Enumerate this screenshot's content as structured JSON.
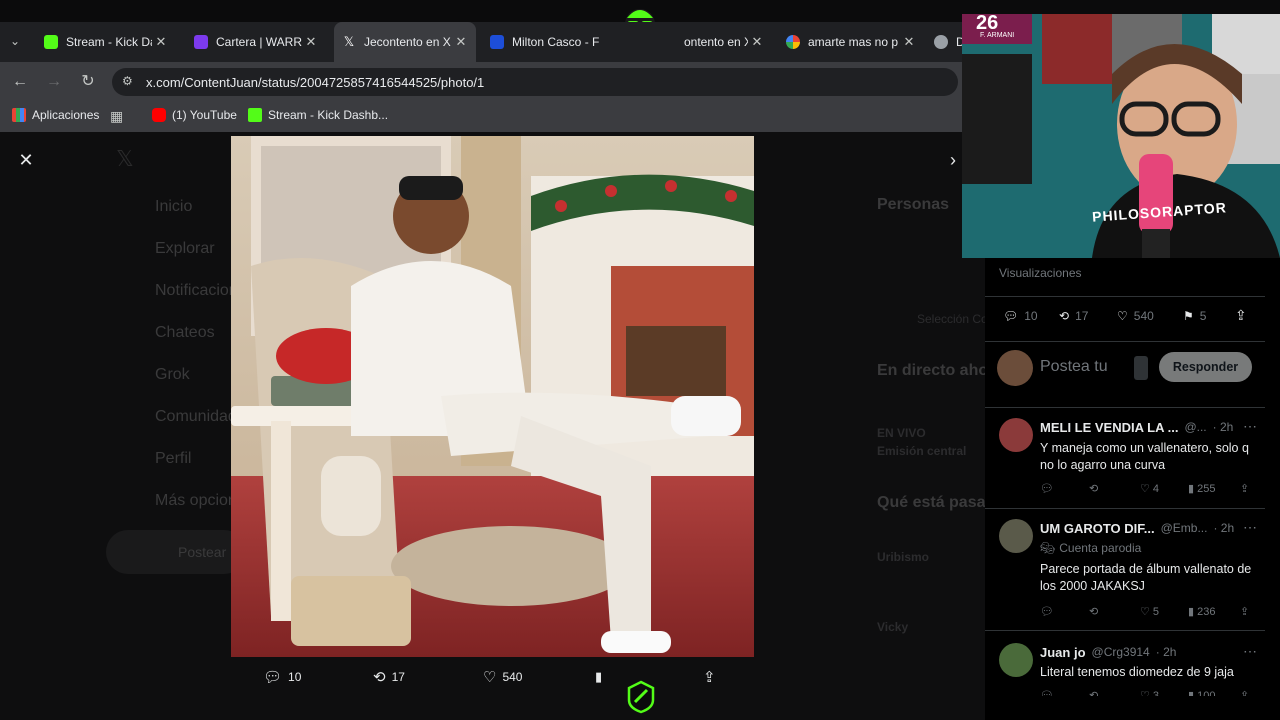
{
  "tabs": [
    {
      "title": "Stream - Kick Da",
      "color": "#53fc18"
    },
    {
      "title": "Cartera | WARRI",
      "color": "#7c3aed"
    },
    {
      "title": "Jecontento en X",
      "color": "#000000",
      "active": true
    },
    {
      "title": "Milton Casco - F",
      "color": "#1d4ed8"
    },
    {
      "title": "ontento en X",
      "color": "#000000"
    },
    {
      "title": "amarte mas no p",
      "color": "#ffffff"
    },
    {
      "title": "D",
      "color": "#9aa0a6"
    }
  ],
  "address": {
    "url": "x.com/ContentJuan/status/2004725857416544525/photo/1"
  },
  "bookmarks": [
    {
      "label": "Aplicaciones",
      "icon": "apps-grid-icon"
    },
    {
      "label": "(1) YouTube",
      "color": "#ff0000"
    },
    {
      "label": "Stream - Kick Dashb...",
      "color": "#53fc18"
    }
  ],
  "sidebar_ghost": [
    "Inicio",
    "Explorar",
    "Notificaciones",
    "Chateos",
    "Grok",
    "Comunidades",
    "Perfil",
    "Más opciones",
    "Postear"
  ],
  "right_ghost": [
    "Personas",
    "En directo ahora",
    "Qué está pasando",
    "Uribismo",
    "Vicky",
    "Selección Colombia",
    "EN VIVO",
    "Emisión central"
  ],
  "photo_actions": {
    "replies": "10",
    "reposts": "17",
    "likes": "540"
  },
  "tweet_stats": {
    "views_label": "Visualizaciones",
    "replies": "10",
    "reposts": "17",
    "likes": "540",
    "bookmarks": "5"
  },
  "composer": {
    "placeholder": "Postea tu",
    "reply_button": "Responder"
  },
  "replies": [
    {
      "name": "MELI LE VENDIA LA ...",
      "handle": "@...",
      "time": "· 2h",
      "badge": "",
      "text": "Y maneja como un vallenatero, solo q no lo agarro una curva",
      "likes": "4",
      "views": "255",
      "reposts": "",
      "avatar_color": "#8b3a3a"
    },
    {
      "name": "UM GAROTO DIF...",
      "handle": "@Emb...",
      "time": "· 2h",
      "badge": "Cuenta parodia",
      "text": "Parece portada de álbum vallenato de los 2000 JAKAKSJ",
      "likes": "5",
      "views": "236",
      "reposts": "",
      "avatar_color": "#5a5a4a"
    },
    {
      "name": "Juan jo",
      "handle": "@Crg3914",
      "time": "· 2h",
      "badge": "",
      "text": "Literal tenemos diomedez de 9 jaja",
      "likes": "3",
      "views": "100",
      "reposts": "",
      "avatar_color": "#4a6a3a"
    }
  ],
  "webcam": {
    "jersey_number": "26",
    "jersey_name": "F. ARMANI",
    "shirt_text": "PHILOSORAPTOR"
  },
  "colors": {
    "accent": "#53fc18",
    "x_blue": "#1d9bf0",
    "muted": "#71767b"
  }
}
